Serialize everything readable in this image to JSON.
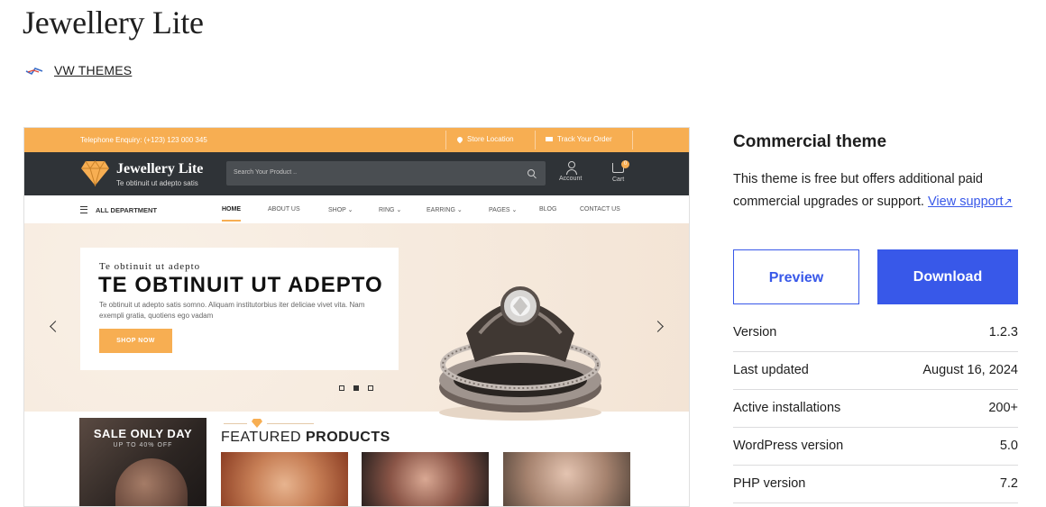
{
  "theme": {
    "title": "Jewellery Lite",
    "author": "VW THEMES"
  },
  "preview_shot": {
    "topbar": {
      "enquiry": "Telephone Enquiry: (+123) 123 000 345",
      "store_location": "Store Location",
      "track_order": "Track Your Order"
    },
    "header": {
      "brand": "Jewellery Lite",
      "tagline": "Te obtinuit ut adepto satis",
      "search_placeholder": "Search Your Product ..",
      "account_label": "Account",
      "cart_label": "Cart",
      "cart_count": "0"
    },
    "nav": {
      "all_department": "ALL DEPARTMENT",
      "items": [
        "HOME",
        "ABOUT US",
        "SHOP ⌄",
        "RING ⌄",
        "EARRING ⌄",
        "PAGES ⌄",
        "BLOG",
        "CONTACT US"
      ]
    },
    "hero": {
      "kicker": "Te obtinuit ut adepto",
      "heading": "TE OBTINUIT UT ADEPTO",
      "text": "Te obtinuit ut adepto satis somno. Aliquam institutorbius iter deliciae vivet vita. Nam exempli gratia, quotiens ego vadam",
      "button": "SHOP NOW"
    },
    "sale": {
      "title": "SALE ONLY DAY",
      "subtitle": "UP TO 40% OFF"
    },
    "featured": {
      "title_light": "FEATURED ",
      "title_bold": "PRODUCTS"
    }
  },
  "sidebar": {
    "title": "Commercial theme",
    "description": "This theme is free but offers additional paid commercial upgrades or support.",
    "support_link": "View support",
    "support_link_icon": "↗",
    "preview_button": "Preview",
    "download_button": "Download",
    "meta": [
      {
        "label": "Version",
        "value": "1.2.3"
      },
      {
        "label": "Last updated",
        "value": "August 16, 2024"
      },
      {
        "label": "Active installations",
        "value": "200+"
      },
      {
        "label": "WordPress version",
        "value": "5.0"
      },
      {
        "label": "PHP version",
        "value": "7.2"
      }
    ]
  },
  "colors": {
    "accent_blue": "#3858e9",
    "preview_orange": "#f7ae52",
    "preview_dark": "#2f3337"
  }
}
